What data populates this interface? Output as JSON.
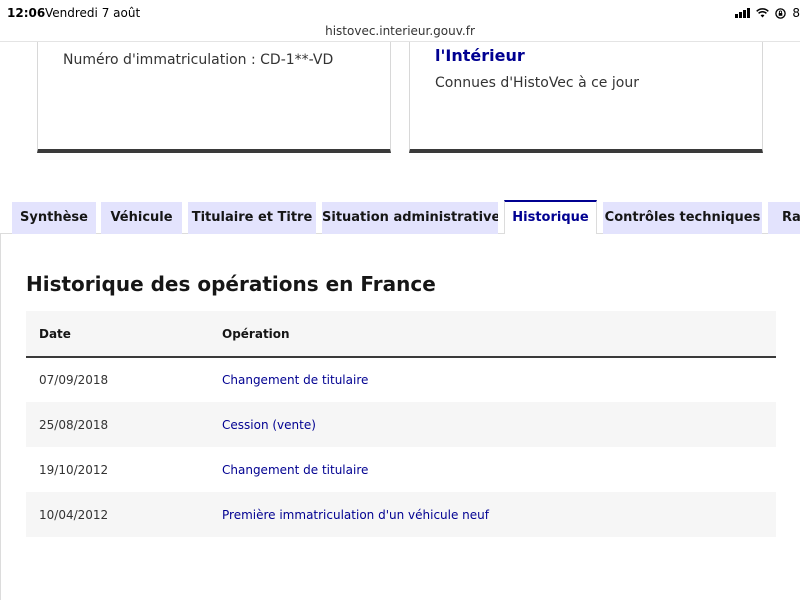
{
  "status_bar": {
    "time": "12:06",
    "date": "Vendredi 7 août",
    "battery": "8"
  },
  "browser": {
    "url": "histovec.interieur.gouv.fr"
  },
  "cards": {
    "left": {
      "immatriculation": "Numéro d'immatriculation : CD-1**-VD"
    },
    "right": {
      "title": "l'Intérieur",
      "subtitle": "Connues d'HistoVec à ce jour"
    }
  },
  "tabs": [
    {
      "label": "Synthèse",
      "active": false
    },
    {
      "label": "Véhicule",
      "active": false
    },
    {
      "label": "Titulaire et Titre",
      "active": false
    },
    {
      "label": "Situation administrative",
      "active": false
    },
    {
      "label": "Historique",
      "active": true
    },
    {
      "label": "Contrôles techniques",
      "active": false
    },
    {
      "label": "Ra",
      "active": false
    }
  ],
  "historique": {
    "title": "Historique des opérations en France",
    "columns": {
      "date": "Date",
      "operation": "Opération"
    },
    "rows": [
      {
        "date": "07/09/2018",
        "operation": "Changement de titulaire"
      },
      {
        "date": "25/08/2018",
        "operation": "Cession (vente)"
      },
      {
        "date": "19/10/2012",
        "operation": "Changement de titulaire"
      },
      {
        "date": "10/04/2012",
        "operation": "Première immatriculation d'un véhicule neuf"
      }
    ]
  },
  "colors": {
    "accent": "#000091",
    "tab_bg": "#e3e3fd",
    "row_stripe": "#f6f6f6"
  }
}
